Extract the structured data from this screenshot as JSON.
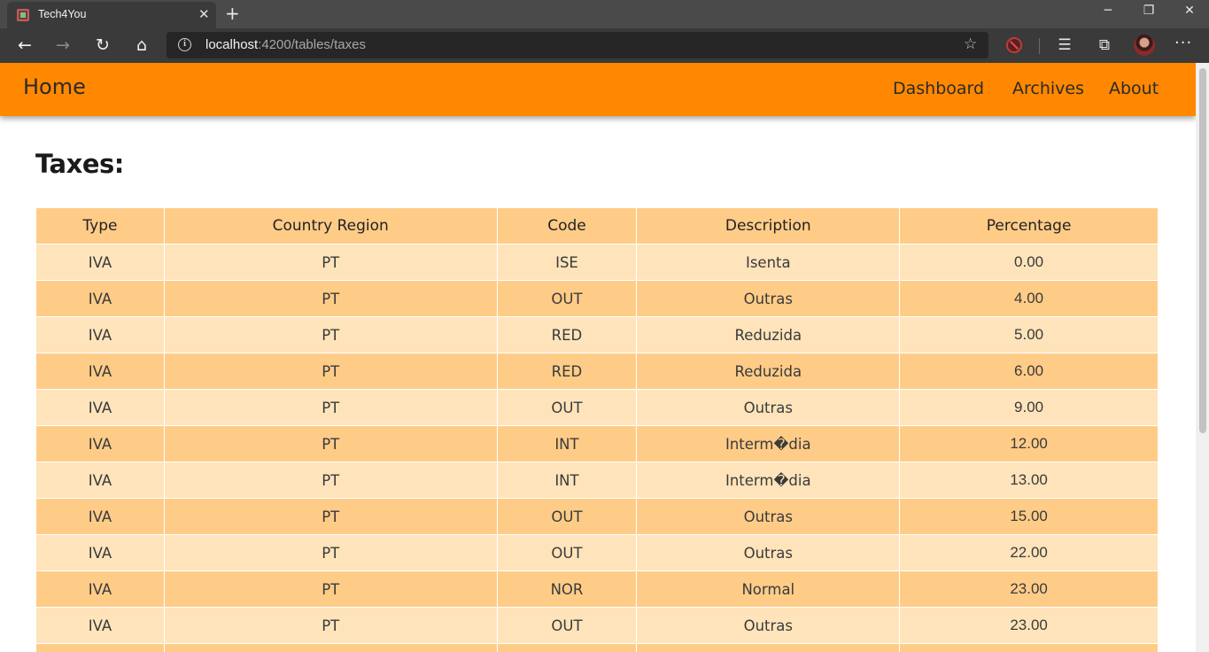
{
  "browser": {
    "tab_title": "Tech4You",
    "tab_close": "✕",
    "new_tab": "+",
    "url_host": "localhost",
    "url_rest": ":4200/tables/taxes",
    "minimize": "─",
    "restore": "❐",
    "close": "✕",
    "more": "···"
  },
  "navbar": {
    "brand": "Home",
    "links": [
      "Dashboard",
      "Archives",
      "About"
    ],
    "color": "#ff8800"
  },
  "page": {
    "title": "Taxes:"
  },
  "table": {
    "columns": [
      "Type",
      "Country Region",
      "Code",
      "Description",
      "Percentage"
    ],
    "rows": [
      [
        "IVA",
        "PT",
        "ISE",
        "Isenta",
        "0.00"
      ],
      [
        "IVA",
        "PT",
        "OUT",
        "Outras",
        "4.00"
      ],
      [
        "IVA",
        "PT",
        "RED",
        "Reduzida",
        "5.00"
      ],
      [
        "IVA",
        "PT",
        "RED",
        "Reduzida",
        "6.00"
      ],
      [
        "IVA",
        "PT",
        "OUT",
        "Outras",
        "9.00"
      ],
      [
        "IVA",
        "PT",
        "INT",
        "Interm�dia",
        "12.00"
      ],
      [
        "IVA",
        "PT",
        "INT",
        "Interm�dia",
        "13.00"
      ],
      [
        "IVA",
        "PT",
        "OUT",
        "Outras",
        "15.00"
      ],
      [
        "IVA",
        "PT",
        "OUT",
        "Outras",
        "22.00"
      ],
      [
        "IVA",
        "PT",
        "NOR",
        "Normal",
        "23.00"
      ],
      [
        "IVA",
        "PT",
        "OUT",
        "Outras",
        "23.00"
      ],
      [
        "",
        "",
        "",
        "",
        ""
      ]
    ]
  },
  "colors": {
    "header_bg": "#ffcc88",
    "row_light": "#ffe4bb",
    "row_dark": "#ffcc88"
  }
}
